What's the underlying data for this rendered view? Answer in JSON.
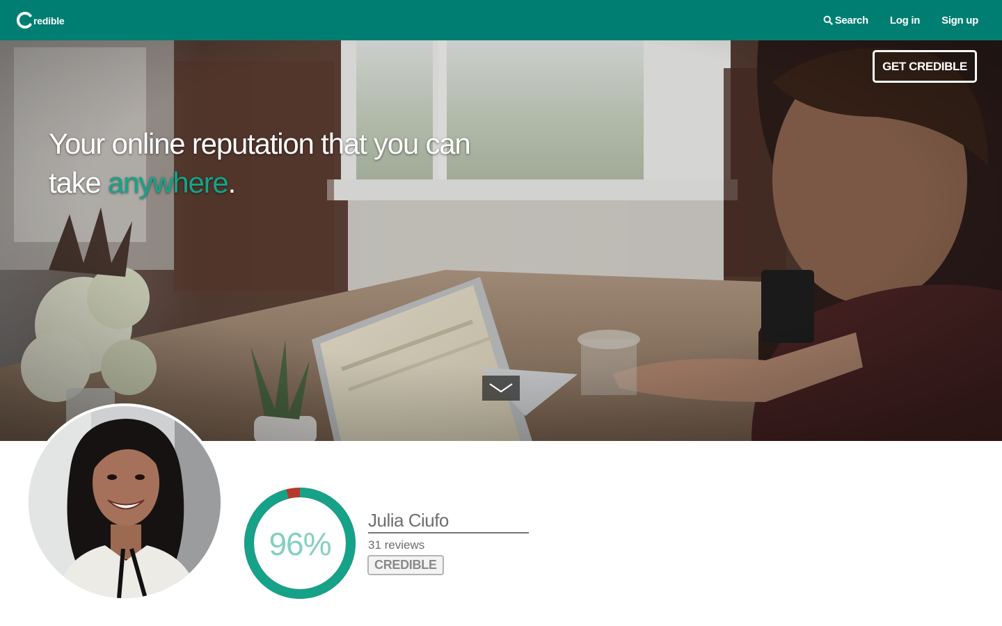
{
  "brand": {
    "logo_text": "redible",
    "primary_color": "#007e72",
    "accent_color": "#14a488"
  },
  "nav": {
    "search_label": "Search",
    "login_label": "Log in",
    "signup_label": "Sign up",
    "search_icon": "search-icon"
  },
  "hero": {
    "cta_label": "GET CREDIBLE",
    "headline_part1": "Your online reputation that you can",
    "headline_part2": "take ",
    "headline_accent": "anywhere",
    "headline_end": ".",
    "scroll_icon": "chevron-down-icon"
  },
  "profile": {
    "name": "Julia Ciufo",
    "reviews": "31 reviews",
    "badge": "CREDIBLE",
    "score_text": "96%",
    "score_fraction": 0.96,
    "score_color": "#16a289",
    "remainder_color": "#b23a2c"
  }
}
